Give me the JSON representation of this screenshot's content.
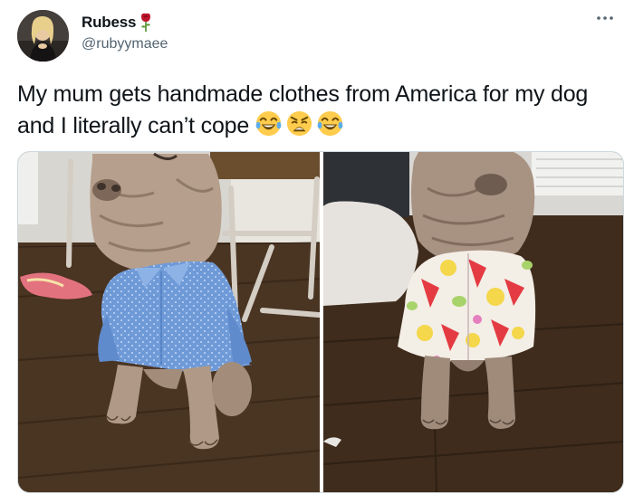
{
  "author": {
    "name": "Rubess",
    "handle": "@rubyymaee",
    "name_emoji": "rose-icon",
    "avatar": "profile-photo"
  },
  "tweet": {
    "text": "My mum gets handmade clothes from America for my dog and I literally can’t cope",
    "emojis": [
      "face-with-tears-of-joy-icon",
      "weary-face-icon",
      "face-with-tears-of-joy-icon"
    ]
  },
  "media": {
    "photos": [
      {
        "subject": "shar-pei-in-blue-polka-dot-shirt"
      },
      {
        "subject": "shar-pei-in-fruit-print-shirt"
      }
    ]
  },
  "colors": {
    "text": "#0f1419",
    "secondary_text": "#536471",
    "border": "#cfd9de",
    "shirt_blue": "#6f9ad8",
    "floor": "#4a3422"
  }
}
